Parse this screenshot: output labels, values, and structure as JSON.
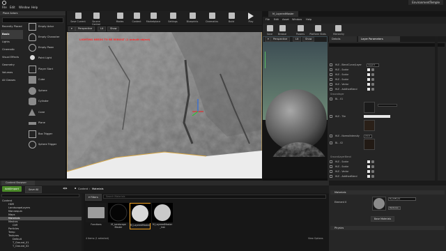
{
  "menu": [
    "File",
    "Edit",
    "Window",
    "Help"
  ],
  "window_title": "EnvironmentTemple",
  "modes": {
    "tab": "Place Actors",
    "categories": [
      "Recently Placed",
      "Basic",
      "Lights",
      "Cinematic",
      "Visual Effects",
      "Geometry",
      "Volumes",
      "All Classes"
    ],
    "items": [
      "Empty Actor",
      "Empty Character",
      "Empty Pawn",
      "Point Light",
      "Player Start",
      "Cube",
      "Sphere",
      "Cylinder",
      "Cone",
      "Plane",
      "Box Trigger",
      "Sphere Trigger"
    ]
  },
  "toolbar": [
    "Save Current",
    "Source Control",
    "Modes",
    "Content",
    "Marketplace",
    "Settings",
    "Blueprints",
    "Cinematics",
    "Build",
    "Play"
  ],
  "viewport": {
    "perspective": "Perspective",
    "lit": "Lit",
    "show": "Show",
    "warning": "LIGHTING NEEDS TO BE REBUILT (1 unbuilt object)"
  },
  "material_editor": {
    "tab": "M_LayeredMaster",
    "menu": [
      "File",
      "Edit",
      "Asset",
      "Window",
      "Help"
    ],
    "tools": [
      "Save",
      "Browse",
      "Params",
      "Platform Stats",
      "Hierarchy"
    ],
    "preview_tabs": [
      "Perspective",
      "Lit",
      "Show"
    ],
    "details_tabs": [
      "Details",
      "Layer Parameters"
    ],
    "rows": [
      "HLE - BlendCurve/Layer",
      "HLE - Scalar",
      "HLE - Scalar",
      "HLE - Scalar",
      "HLE - Vector",
      "HLE - AdditiveBlend",
      "Groundlayer",
      "BL - 01",
      "HLE - Tile",
      "HLE - NormalIntensity",
      "BL - 02",
      "GroundLayerBlend",
      "HLE - Scalar",
      "HLE - Scalar",
      "HLE - Vector",
      "HLE - AdditiveBlend"
    ],
    "values": [
      "Layer1",
      "0.5",
      "0.15",
      "1.0",
      "0.7",
      "24.0",
      "0.0"
    ]
  },
  "content_browser": {
    "tab": "Content Browser",
    "add_new": "Add/Import",
    "save_all": "Save All",
    "path": [
      "Content",
      "Materials"
    ],
    "filters": "Filters",
    "search_placeholder": "Search Materials",
    "tree": [
      "Content",
      "HDR",
      "LandscapeLayers",
      "Mannequin",
      "Maps",
      "Materials",
      "Meshes",
      "Cliff",
      "Particles",
      "Temp",
      "Textures",
      "Default",
      "T_Ground_01",
      "T_Ground_02"
    ],
    "assets": [
      {
        "name": "Functions"
      },
      {
        "name": "M_Landscape Master"
      },
      {
        "name": "M_LayeredMaster"
      },
      {
        "name": "M_LayeredMaster _Inst"
      }
    ],
    "status": "4 items (1 selected)",
    "view_options": "View Options"
  },
  "details_bottom": {
    "materials": "Materials",
    "element": "Element 0",
    "material_name": "M_Cliff_01",
    "textures": "Textures",
    "base_materials": "Base Materials",
    "physics": "Physics"
  }
}
